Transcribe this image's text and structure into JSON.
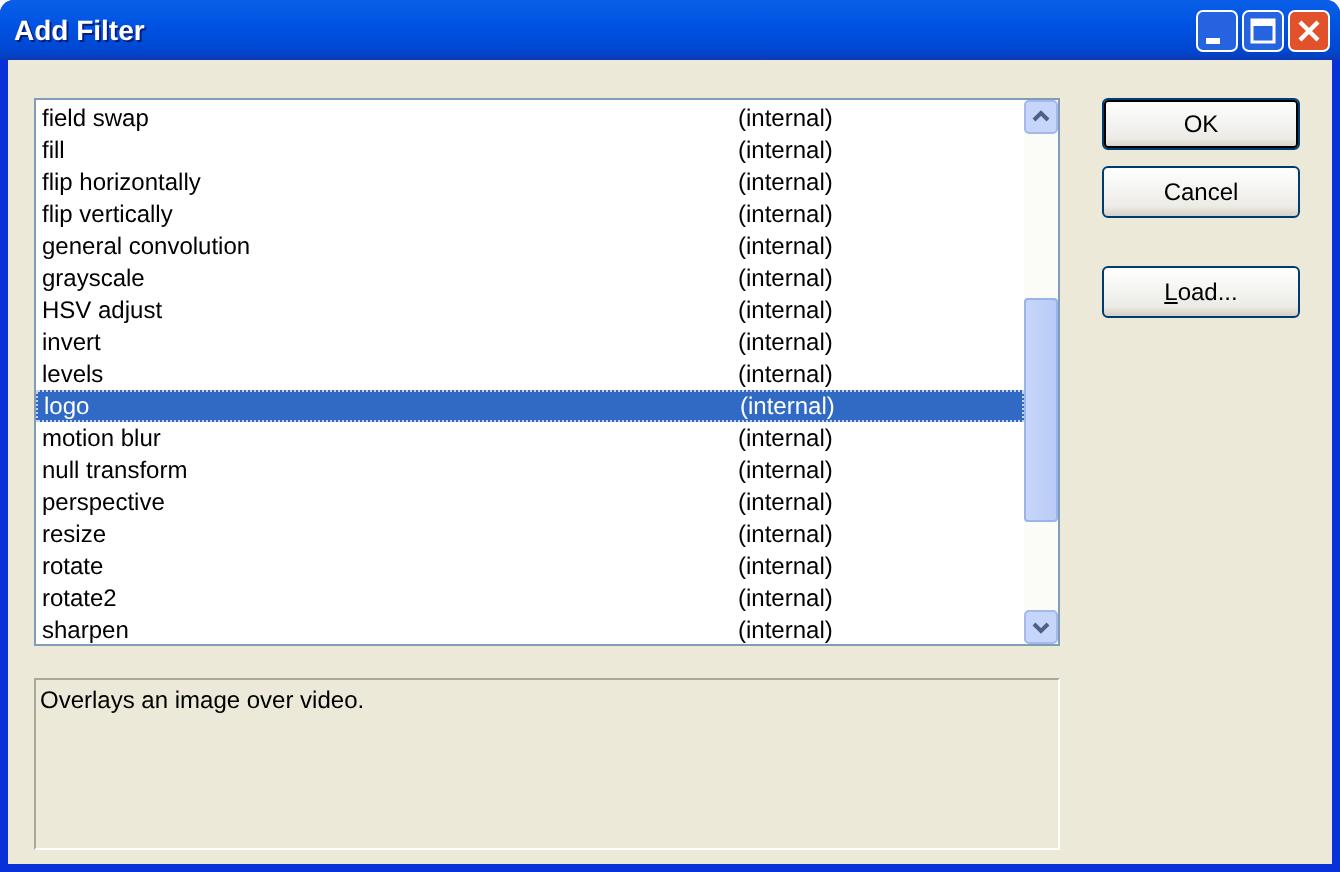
{
  "window": {
    "title": "Add Filter"
  },
  "filters": [
    {
      "name": "field swap",
      "source": "(internal)",
      "selected": false
    },
    {
      "name": "fill",
      "source": "(internal)",
      "selected": false
    },
    {
      "name": "flip horizontally",
      "source": "(internal)",
      "selected": false
    },
    {
      "name": "flip vertically",
      "source": "(internal)",
      "selected": false
    },
    {
      "name": "general convolution",
      "source": "(internal)",
      "selected": false
    },
    {
      "name": "grayscale",
      "source": "(internal)",
      "selected": false
    },
    {
      "name": "HSV adjust",
      "source": "(internal)",
      "selected": false
    },
    {
      "name": "invert",
      "source": "(internal)",
      "selected": false
    },
    {
      "name": "levels",
      "source": "(internal)",
      "selected": false
    },
    {
      "name": "logo",
      "source": "(internal)",
      "selected": true
    },
    {
      "name": "motion blur",
      "source": "(internal)",
      "selected": false
    },
    {
      "name": "null transform",
      "source": "(internal)",
      "selected": false
    },
    {
      "name": "perspective",
      "source": "(internal)",
      "selected": false
    },
    {
      "name": "resize",
      "source": "(internal)",
      "selected": false
    },
    {
      "name": "rotate",
      "source": "(internal)",
      "selected": false
    },
    {
      "name": "rotate2",
      "source": "(internal)",
      "selected": false
    },
    {
      "name": "sharpen",
      "source": "(internal)",
      "selected": false
    }
  ],
  "description": "Overlays an image over video.",
  "buttons": [
    {
      "label": "OK",
      "kind": "default"
    },
    {
      "label": "Cancel",
      "kind": "normal"
    },
    {
      "label": "Load...",
      "kind": "accel"
    }
  ]
}
